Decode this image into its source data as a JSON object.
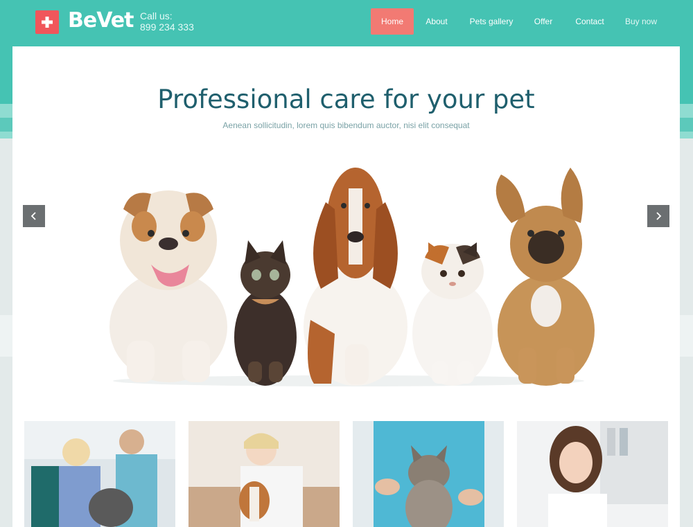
{
  "header": {
    "brand": "BeVet",
    "call_label": "Call us:",
    "call_number": "899 234 333",
    "nav": [
      {
        "label": "Home",
        "active": true
      },
      {
        "label": "About",
        "active": false
      },
      {
        "label": "Pets gallery",
        "active": false
      },
      {
        "label": "Offer",
        "active": false
      },
      {
        "label": "Contact",
        "active": false
      },
      {
        "label": "Buy now",
        "active": false
      }
    ]
  },
  "hero": {
    "title": "Professional care for your pet",
    "subtitle": "Aenean sollicitudin, lorem quis bibendum auctor, nisi elit consequat"
  },
  "slider": {
    "prev_icon": "chevron-left-icon",
    "next_icon": "chevron-right-icon",
    "image": "pets-group-photo"
  },
  "thumbnails": [
    {
      "image": "vets-with-dog-photo"
    },
    {
      "image": "vet-with-beagle-photo"
    },
    {
      "image": "vet-holding-cat-photo"
    },
    {
      "image": "woman-portrait-photo"
    }
  ],
  "colors": {
    "header_bg": "#45c3b3",
    "accent": "#f27a73",
    "logo": "#f0565b",
    "title": "#1f5f6d",
    "subtitle": "#7aa2a6"
  }
}
